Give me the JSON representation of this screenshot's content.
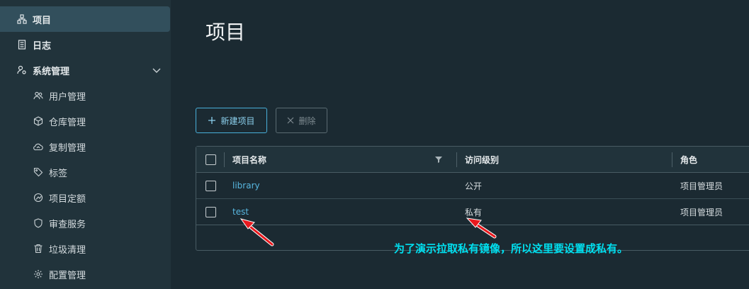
{
  "sidebar": {
    "items": [
      {
        "label": "项目",
        "icon": "projects-icon",
        "active": true
      },
      {
        "label": "日志",
        "icon": "logs-icon"
      },
      {
        "label": "系统管理",
        "icon": "admin-icon",
        "expanded": true
      }
    ],
    "sub_items": [
      {
        "label": "用户管理",
        "icon": "users-icon"
      },
      {
        "label": "仓库管理",
        "icon": "registry-icon"
      },
      {
        "label": "复制管理",
        "icon": "replication-icon"
      },
      {
        "label": "标签",
        "icon": "tag-icon"
      },
      {
        "label": "项目定额",
        "icon": "quota-icon"
      },
      {
        "label": "审查服务",
        "icon": "shield-icon"
      },
      {
        "label": "垃圾清理",
        "icon": "trash-icon"
      },
      {
        "label": "配置管理",
        "icon": "gear-icon"
      }
    ]
  },
  "main": {
    "title": "项目",
    "toolbar": {
      "new_label": "新建项目",
      "delete_label": "删除"
    },
    "table": {
      "columns": [
        "项目名称",
        "访问级别",
        "角色"
      ],
      "rows": [
        {
          "name": "library",
          "access": "公开",
          "role": "项目管理员"
        },
        {
          "name": "test",
          "access": "私有",
          "role": "项目管理员"
        }
      ]
    }
  },
  "annotation": {
    "text": "为了演示拉取私有镜像，所以这里要设置成私有。",
    "color": "#00e0f0",
    "arrow_color": "#e8191e"
  }
}
